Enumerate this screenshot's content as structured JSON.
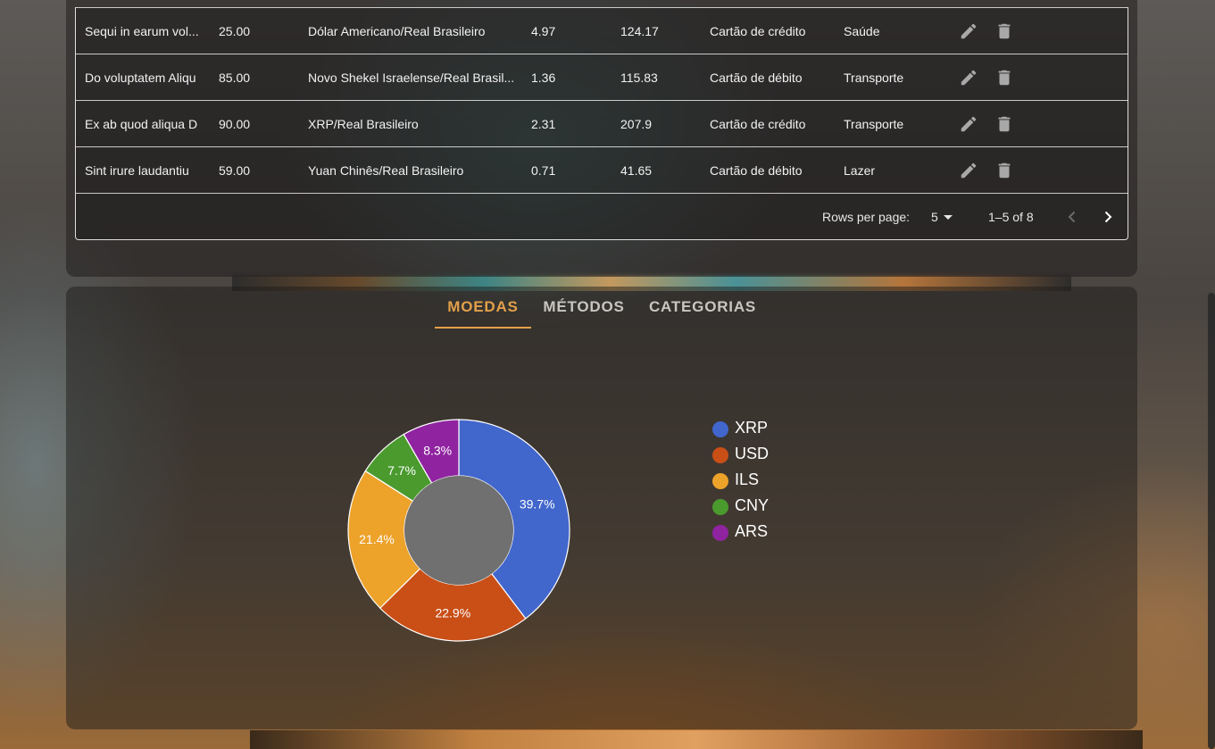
{
  "table": {
    "rows": [
      {
        "description": "Sequi in earum vol...",
        "value": "25.00",
        "currency": "Dólar Americano/Real Brasileiro",
        "rate": "4.97",
        "converted": "124.17",
        "method": "Cartão de crédito",
        "category": "Saúde"
      },
      {
        "description": "Do voluptatem Aliqu",
        "value": "85.00",
        "currency": "Novo Shekel Israelense/Real Brasil...",
        "rate": "1.36",
        "converted": "115.83",
        "method": "Cartão de débito",
        "category": "Transporte"
      },
      {
        "description": "Ex ab quod aliqua D",
        "value": "90.00",
        "currency": "XRP/Real Brasileiro",
        "rate": "2.31",
        "converted": "207.9",
        "method": "Cartão de crédito",
        "category": "Transporte"
      },
      {
        "description": "Sint irure laudantiu",
        "value": "59.00",
        "currency": "Yuan Chinês/Real Brasileiro",
        "rate": "0.71",
        "converted": "41.65",
        "method": "Cartão de débito",
        "category": "Lazer"
      }
    ],
    "edit_icon": "pencil-icon",
    "delete_icon": "trash-icon"
  },
  "pagination": {
    "rows_per_page_label": "Rows per page:",
    "rows_per_page_value": "5",
    "range_text": "1–5 of 8"
  },
  "tabs": {
    "items": [
      "MOEDAS",
      "MÉTODOS",
      "CATEGORIAS"
    ],
    "active": "MOEDAS",
    "accent_color": "#e3a04a"
  },
  "chart_data": {
    "type": "pie",
    "categories": [
      "XRP",
      "USD",
      "ILS",
      "CNY",
      "ARS"
    ],
    "values": [
      39.7,
      22.9,
      21.4,
      7.7,
      8.3
    ],
    "labels": [
      "39.7%",
      "22.9%",
      "21.4%",
      "7.7%",
      "8.3%"
    ],
    "colors": [
      "#4166cc",
      "#c94f17",
      "#eda22a",
      "#4a9a2e",
      "#8f23a0"
    ],
    "legend_position": "right"
  }
}
